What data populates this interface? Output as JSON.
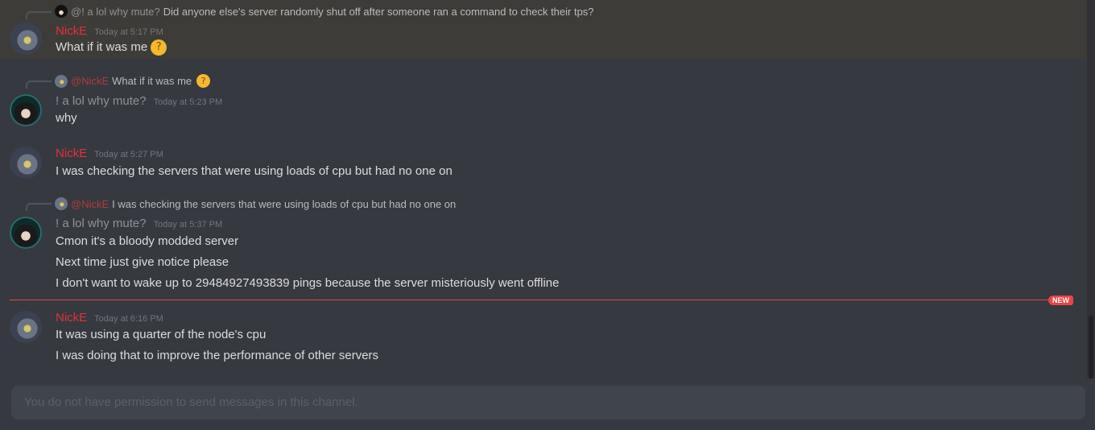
{
  "messages": [
    {
      "reply": {
        "mention": "@! a lol why mute?",
        "text": "Did anyone else's server randomly shut off after someone ran a command to check their tps?"
      },
      "author": "NickE",
      "timestamp": "Today at 5:17 PM",
      "lines": [
        "What if it was me"
      ],
      "emoji": "thinking-face"
    },
    {
      "reply": {
        "mention": "@NickE",
        "text": "What if it was me"
      },
      "author": "! a lol why mute?",
      "timestamp": "Today at 5:23 PM",
      "lines": [
        "why"
      ]
    },
    {
      "author": "NickE",
      "timestamp": "Today at 5:27 PM",
      "lines": [
        "I was checking the servers that were using loads of cpu but had no one on"
      ]
    },
    {
      "reply": {
        "mention": "@NickE",
        "text": "I was checking the servers that were using loads of cpu but had no one on"
      },
      "author": "! a lol why mute?",
      "timestamp": "Today at 5:37 PM",
      "lines": [
        "Cmon it's a bloody modded server",
        "Next time just give notice please",
        "I don't want to wake up to 29484927493839 pings because the server misteriously went offline"
      ]
    },
    {
      "author": "NickE",
      "timestamp": "Today at 6:16 PM",
      "lines": [
        "It was using a quarter of the node's cpu",
        "I was doing that to improve the performance of other servers"
      ]
    }
  ],
  "divider": {
    "badge": "NEW",
    "color": "#ed4245"
  },
  "input": {
    "placeholder": "You do not have permission to send messages in this channel."
  },
  "colors": {
    "nick_name": "#e5303a",
    "background": "#36393f",
    "highlight": "#3e3c38"
  }
}
